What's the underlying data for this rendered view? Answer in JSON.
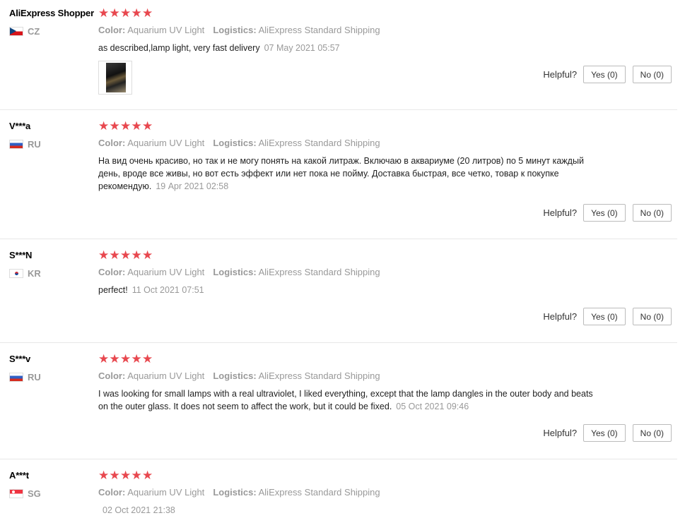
{
  "helpful_label": "Helpful?",
  "reviews": [
    {
      "user": "AliExpress Shopper",
      "country": "CZ",
      "flag": "cz-flag",
      "stars": 5,
      "color_label": "Color:",
      "color_value": "Aquarium UV Light",
      "logistics_label": "Logistics:",
      "logistics_value": "AliExpress Standard Shipping",
      "text": "as described,lamp light, very fast delivery",
      "date": "07 May 2021 05:57",
      "yes": "Yes (0)",
      "no": "No (0)",
      "has_photo": true
    },
    {
      "user": "V***a",
      "country": "RU",
      "flag": "ru-flag",
      "stars": 5,
      "color_label": "Color:",
      "color_value": "Aquarium UV Light",
      "logistics_label": "Logistics:",
      "logistics_value": "AliExpress Standard Shipping",
      "text": "На вид очень красиво, но так и не могу понять на какой литраж. Включаю в аквариуме (20 литров) по 5 минут каждый день, вроде все живы, но вот есть эффект или нет пока не пойму. Доставка быстрая, все четко, товар к покупке рекомендую.",
      "date": "19 Apr 2021 02:58",
      "yes": "Yes (0)",
      "no": "No (0)"
    },
    {
      "user": "S***N",
      "country": "KR",
      "flag": "kr-flag",
      "stars": 5,
      "color_label": "Color:",
      "color_value": "Aquarium UV Light",
      "logistics_label": "Logistics:",
      "logistics_value": "AliExpress Standard Shipping",
      "text": "perfect!",
      "date": "11 Oct 2021 07:51",
      "yes": "Yes (0)",
      "no": "No (0)"
    },
    {
      "user": "S***v",
      "country": "RU",
      "flag": "ru-flag",
      "stars": 5,
      "color_label": "Color:",
      "color_value": "Aquarium UV Light",
      "logistics_label": "Logistics:",
      "logistics_value": "AliExpress Standard Shipping",
      "text": "I was looking for small lamps with a real ultraviolet, I liked everything, except that the lamp dangles in the outer body and beats on the outer glass. It does not seem to affect the work, but it could be fixed.",
      "date": "05 Oct 2021 09:46",
      "yes": "Yes (0)",
      "no": "No (0)"
    },
    {
      "user": "A***t",
      "country": "SG",
      "flag": "sg-flag",
      "stars": 5,
      "color_label": "Color:",
      "color_value": "Aquarium UV Light",
      "logistics_label": "Logistics:",
      "logistics_value": "AliExpress Standard Shipping",
      "text": "",
      "date": "02 Oct 2021 21:38"
    }
  ]
}
